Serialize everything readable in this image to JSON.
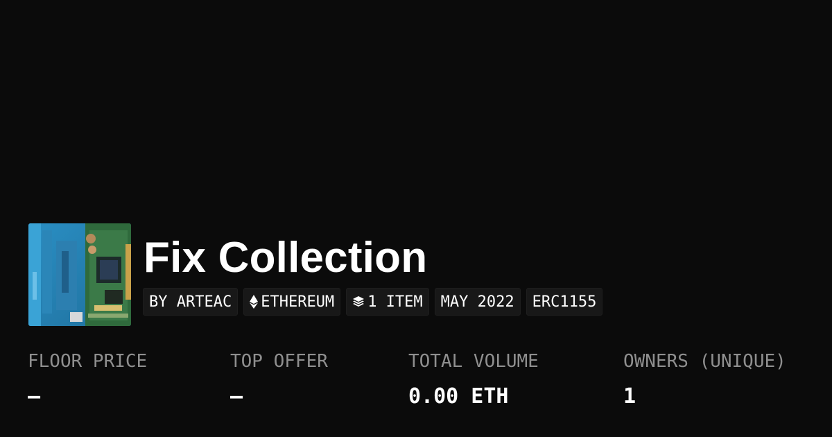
{
  "collection": {
    "title": "Fix Collection",
    "thumbnail_icon": "collection-image"
  },
  "tags": {
    "creator": "BY ARTEAC",
    "chain": "ETHEREUM",
    "chain_icon": "ethereum-icon",
    "items": "1 ITEM",
    "items_icon": "layers-icon",
    "date": "MAY 2022",
    "standard": "ERC1155"
  },
  "stats": {
    "floor_price_label": "FLOOR PRICE",
    "floor_price_value": "–",
    "top_offer_label": "TOP OFFER",
    "top_offer_value": "–",
    "total_volume_label": "TOTAL VOLUME",
    "total_volume_value": "0.00 ETH",
    "owners_label": "OWNERS (UNIQUE)",
    "owners_value": "1"
  },
  "colors": {
    "background": "#0b0b0b",
    "tag_background": "#181818",
    "label_gray": "#8f8f8f",
    "text": "#ffffff"
  }
}
